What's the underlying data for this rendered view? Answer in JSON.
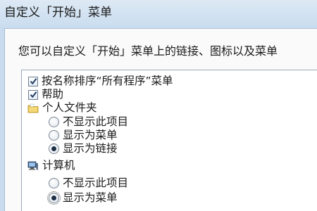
{
  "dialog": {
    "title": "自定义「开始」菜单"
  },
  "intro_text": "您可以自定义「开始」菜单上的链接、图标以及菜单",
  "items": [
    {
      "type": "checkbox",
      "label": "按名称排序“所有程序”菜单",
      "checked": true
    },
    {
      "type": "checkbox",
      "label": "帮助",
      "checked": true
    },
    {
      "type": "group",
      "icon": "folder-icon",
      "label": "个人文件夹"
    },
    {
      "type": "radio",
      "label": "不显示此项目",
      "selected": false
    },
    {
      "type": "radio",
      "label": "显示为菜单",
      "selected": false
    },
    {
      "type": "radio",
      "label": "显示为链接",
      "selected": true
    },
    {
      "type": "group",
      "icon": "computer-icon",
      "label": "计算机"
    },
    {
      "type": "radio",
      "label": "不显示此项目",
      "selected": false
    },
    {
      "type": "radio",
      "label": "显示为菜单",
      "selected": true
    }
  ],
  "colors": {
    "titlebar": "#c9dcef",
    "listbox_border": "#9aa7b7",
    "check_mark": "#1f3c63"
  }
}
